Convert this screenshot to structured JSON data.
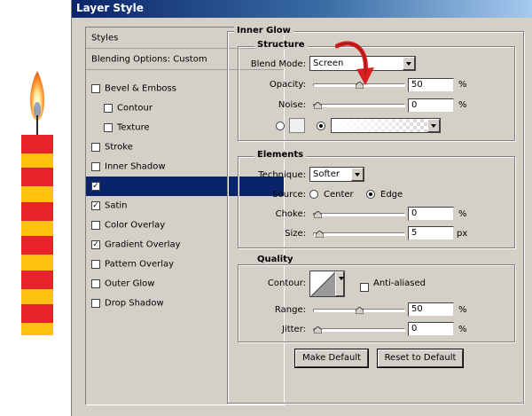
{
  "window": {
    "title": "Layer Style"
  },
  "sidebar": {
    "styles_label": "Styles",
    "blending_label": "Blending Options: Custom",
    "items": [
      {
        "label": "Bevel & Emboss",
        "checked": false
      },
      {
        "label": "Contour",
        "checked": false
      },
      {
        "label": "Texture",
        "checked": false
      },
      {
        "label": "Stroke",
        "checked": false
      },
      {
        "label": "Inner Shadow",
        "checked": false
      },
      {
        "label": "",
        "checked": true,
        "selected": true
      },
      {
        "label": "Satin",
        "checked": true
      },
      {
        "label": "Color Overlay",
        "checked": false
      },
      {
        "label": "Gradient Overlay",
        "checked": true
      },
      {
        "label": "Pattern Overlay",
        "checked": false
      },
      {
        "label": "Outer Glow",
        "checked": false
      },
      {
        "label": "Drop Shadow",
        "checked": false
      }
    ]
  },
  "inner_glow": {
    "title": "Inner Glow",
    "structure": {
      "title": "Structure",
      "blend_mode_label": "Blend Mode:",
      "blend_mode_value": "Screen",
      "opacity_label": "Opacity:",
      "opacity_value": "50",
      "opacity_fraction": 0.5,
      "noise_label": "Noise:",
      "noise_value": "0",
      "noise_fraction": 0,
      "unit_percent": "%"
    },
    "elements": {
      "title": "Elements",
      "technique_label": "Technique:",
      "technique_value": "Softer",
      "source_label": "Source:",
      "center_label": "Center",
      "edge_label": "Edge",
      "choke_label": "Choke:",
      "choke_value": "0",
      "choke_fraction": 0,
      "size_label": "Size:",
      "size_value": "5",
      "size_fraction": 0.02,
      "unit_percent": "%",
      "unit_px": "px"
    },
    "quality": {
      "title": "Quality",
      "contour_label": "Contour:",
      "anti_aliased_label": "Anti-aliased",
      "range_label": "Range:",
      "range_value": "50",
      "range_fraction": 0.5,
      "jitter_label": "Jitter:",
      "jitter_value": "0",
      "jitter_fraction": 0,
      "unit_percent": "%"
    },
    "buttons": {
      "make_default": "Make Default",
      "reset_default": "Reset to Default"
    }
  },
  "colors": {
    "dialog_bg": "#d4d0c8",
    "title_bar": "#0a246a",
    "selection": "#0a246a",
    "candle_red": "#e8222a",
    "candle_yellow": "#ffc20e",
    "annotation_arrow": "#d81f1f"
  },
  "icons": {
    "candle": "candle-illustration",
    "arrow": "red-curved-arrow-icon",
    "dropdown": "chevron-down-icon"
  }
}
